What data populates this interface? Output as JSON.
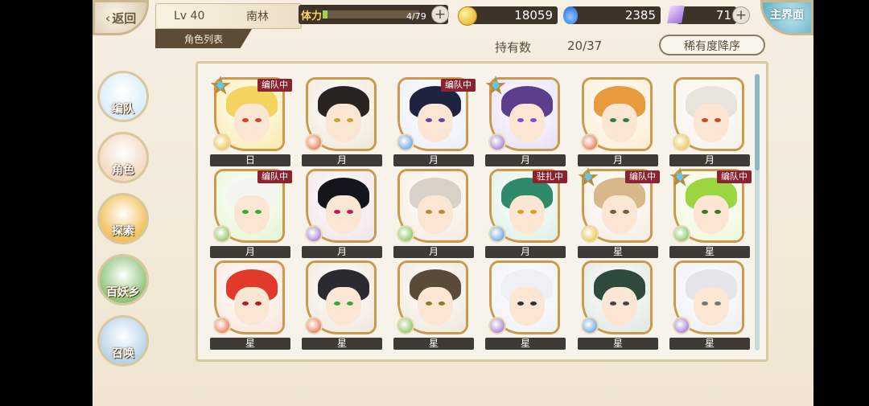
{
  "header": {
    "back_label": "返回",
    "level": "Lv 40",
    "player_name": "南林",
    "tab_label": "角色列表",
    "stamina_label": "体力",
    "stamina_value": "4/79",
    "stamina_fraction": 0.05,
    "coins": "18059",
    "spirit": "2385",
    "crystals": "71",
    "home_label": "主界面"
  },
  "roster": {
    "count_label": "持有数",
    "count_value": "20/37",
    "sort_label": "稀有度降序"
  },
  "sidebar": {
    "items": [
      {
        "label": "编队",
        "color": "#d9eef9"
      },
      {
        "label": "角色",
        "color": "#f3d9c2"
      },
      {
        "label": "探索",
        "color": "#f2c25a"
      },
      {
        "label": "百妖乡",
        "color": "#8fc47a"
      },
      {
        "label": "召唤",
        "color": "#b7d4ea"
      }
    ]
  },
  "cards": [
    {
      "name": "日",
      "badge": "编队中",
      "star": true,
      "hair": "#f4d35e",
      "bg": "#fbe9a8",
      "elem": "#e8b827",
      "eye": "#c43"
    },
    {
      "name": "月",
      "badge": "",
      "star": false,
      "hair": "#2a2420",
      "bg": "#efe6d6",
      "elem": "#e0582a",
      "eye": "#c9a22a"
    },
    {
      "name": "月",
      "badge": "编队中",
      "star": false,
      "hair": "#1e2340",
      "bg": "#e9eefa",
      "elem": "#3e8ee0",
      "eye": "#6b3fb2"
    },
    {
      "name": "月",
      "badge": "",
      "star": true,
      "hair": "#5b3f8c",
      "bg": "#e7def5",
      "elem": "#8b5fcc",
      "eye": "#7a4fcf"
    },
    {
      "name": "月",
      "badge": "",
      "star": false,
      "hair": "#e89a3c",
      "bg": "#fdebd0",
      "elem": "#e0582a",
      "eye": "#3b7a3b"
    },
    {
      "name": "月",
      "badge": "",
      "star": false,
      "hair": "#e8e4dc",
      "bg": "#f6f1e9",
      "elem": "#e8b827",
      "eye": "#c43"
    },
    {
      "name": "月",
      "badge": "编队中",
      "star": false,
      "hair": "#f4f4f0",
      "bg": "#e4f4d2",
      "elem": "#6bb93a",
      "eye": "#3aa83a"
    },
    {
      "name": "月",
      "badge": "",
      "star": false,
      "hair": "#14161e",
      "bg": "#efe3e8",
      "elem": "#8b5fcc",
      "eye": "#c2185b"
    },
    {
      "name": "月",
      "badge": "",
      "star": false,
      "hair": "#d9d0c6",
      "bg": "#f6eadf",
      "elem": "#6bb93a",
      "eye": "#b88a2a"
    },
    {
      "name": "月",
      "badge": "驻扎中",
      "star": false,
      "hair": "#2f8a6a",
      "bg": "#dcefe4",
      "elem": "#3e8ee0",
      "eye": "#d4a020"
    },
    {
      "name": "星",
      "badge": "编队中",
      "star": true,
      "hair": "#d8b88a",
      "bg": "#f5ece0",
      "elem": "#e8b827",
      "eye": "#7a5a3a"
    },
    {
      "name": "星",
      "badge": "编队中",
      "star": true,
      "hair": "#9bd640",
      "bg": "#eef7d8",
      "elem": "#6bb93a",
      "eye": "#3a7a2a"
    },
    {
      "name": "星",
      "badge": "",
      "star": false,
      "hair": "#e23a2a",
      "bg": "#fbe4dc",
      "elem": "#e0582a",
      "eye": "#b02020"
    },
    {
      "name": "星",
      "badge": "",
      "star": false,
      "hair": "#2a2a30",
      "bg": "#efe6dc",
      "elem": "#e0582a",
      "eye": "#3aa83a"
    },
    {
      "name": "星",
      "badge": "",
      "star": false,
      "hair": "#5a4a3a",
      "bg": "#eee6da",
      "elem": "#6bb93a",
      "eye": "#8a7a2a"
    },
    {
      "name": "星",
      "badge": "",
      "star": false,
      "hair": "#eef0f4",
      "bg": "#eef0f4",
      "elem": "#8b5fcc",
      "eye": "#333"
    },
    {
      "name": "星",
      "badge": "",
      "star": false,
      "hair": "#2f4a3a",
      "bg": "#dfe6e0",
      "elem": "#3e8ee0",
      "eye": "#444"
    },
    {
      "name": "星",
      "badge": "",
      "star": false,
      "hair": "#e4e4ea",
      "bg": "#eceef2",
      "elem": "#8b5fcc",
      "eye": "#777"
    }
  ]
}
